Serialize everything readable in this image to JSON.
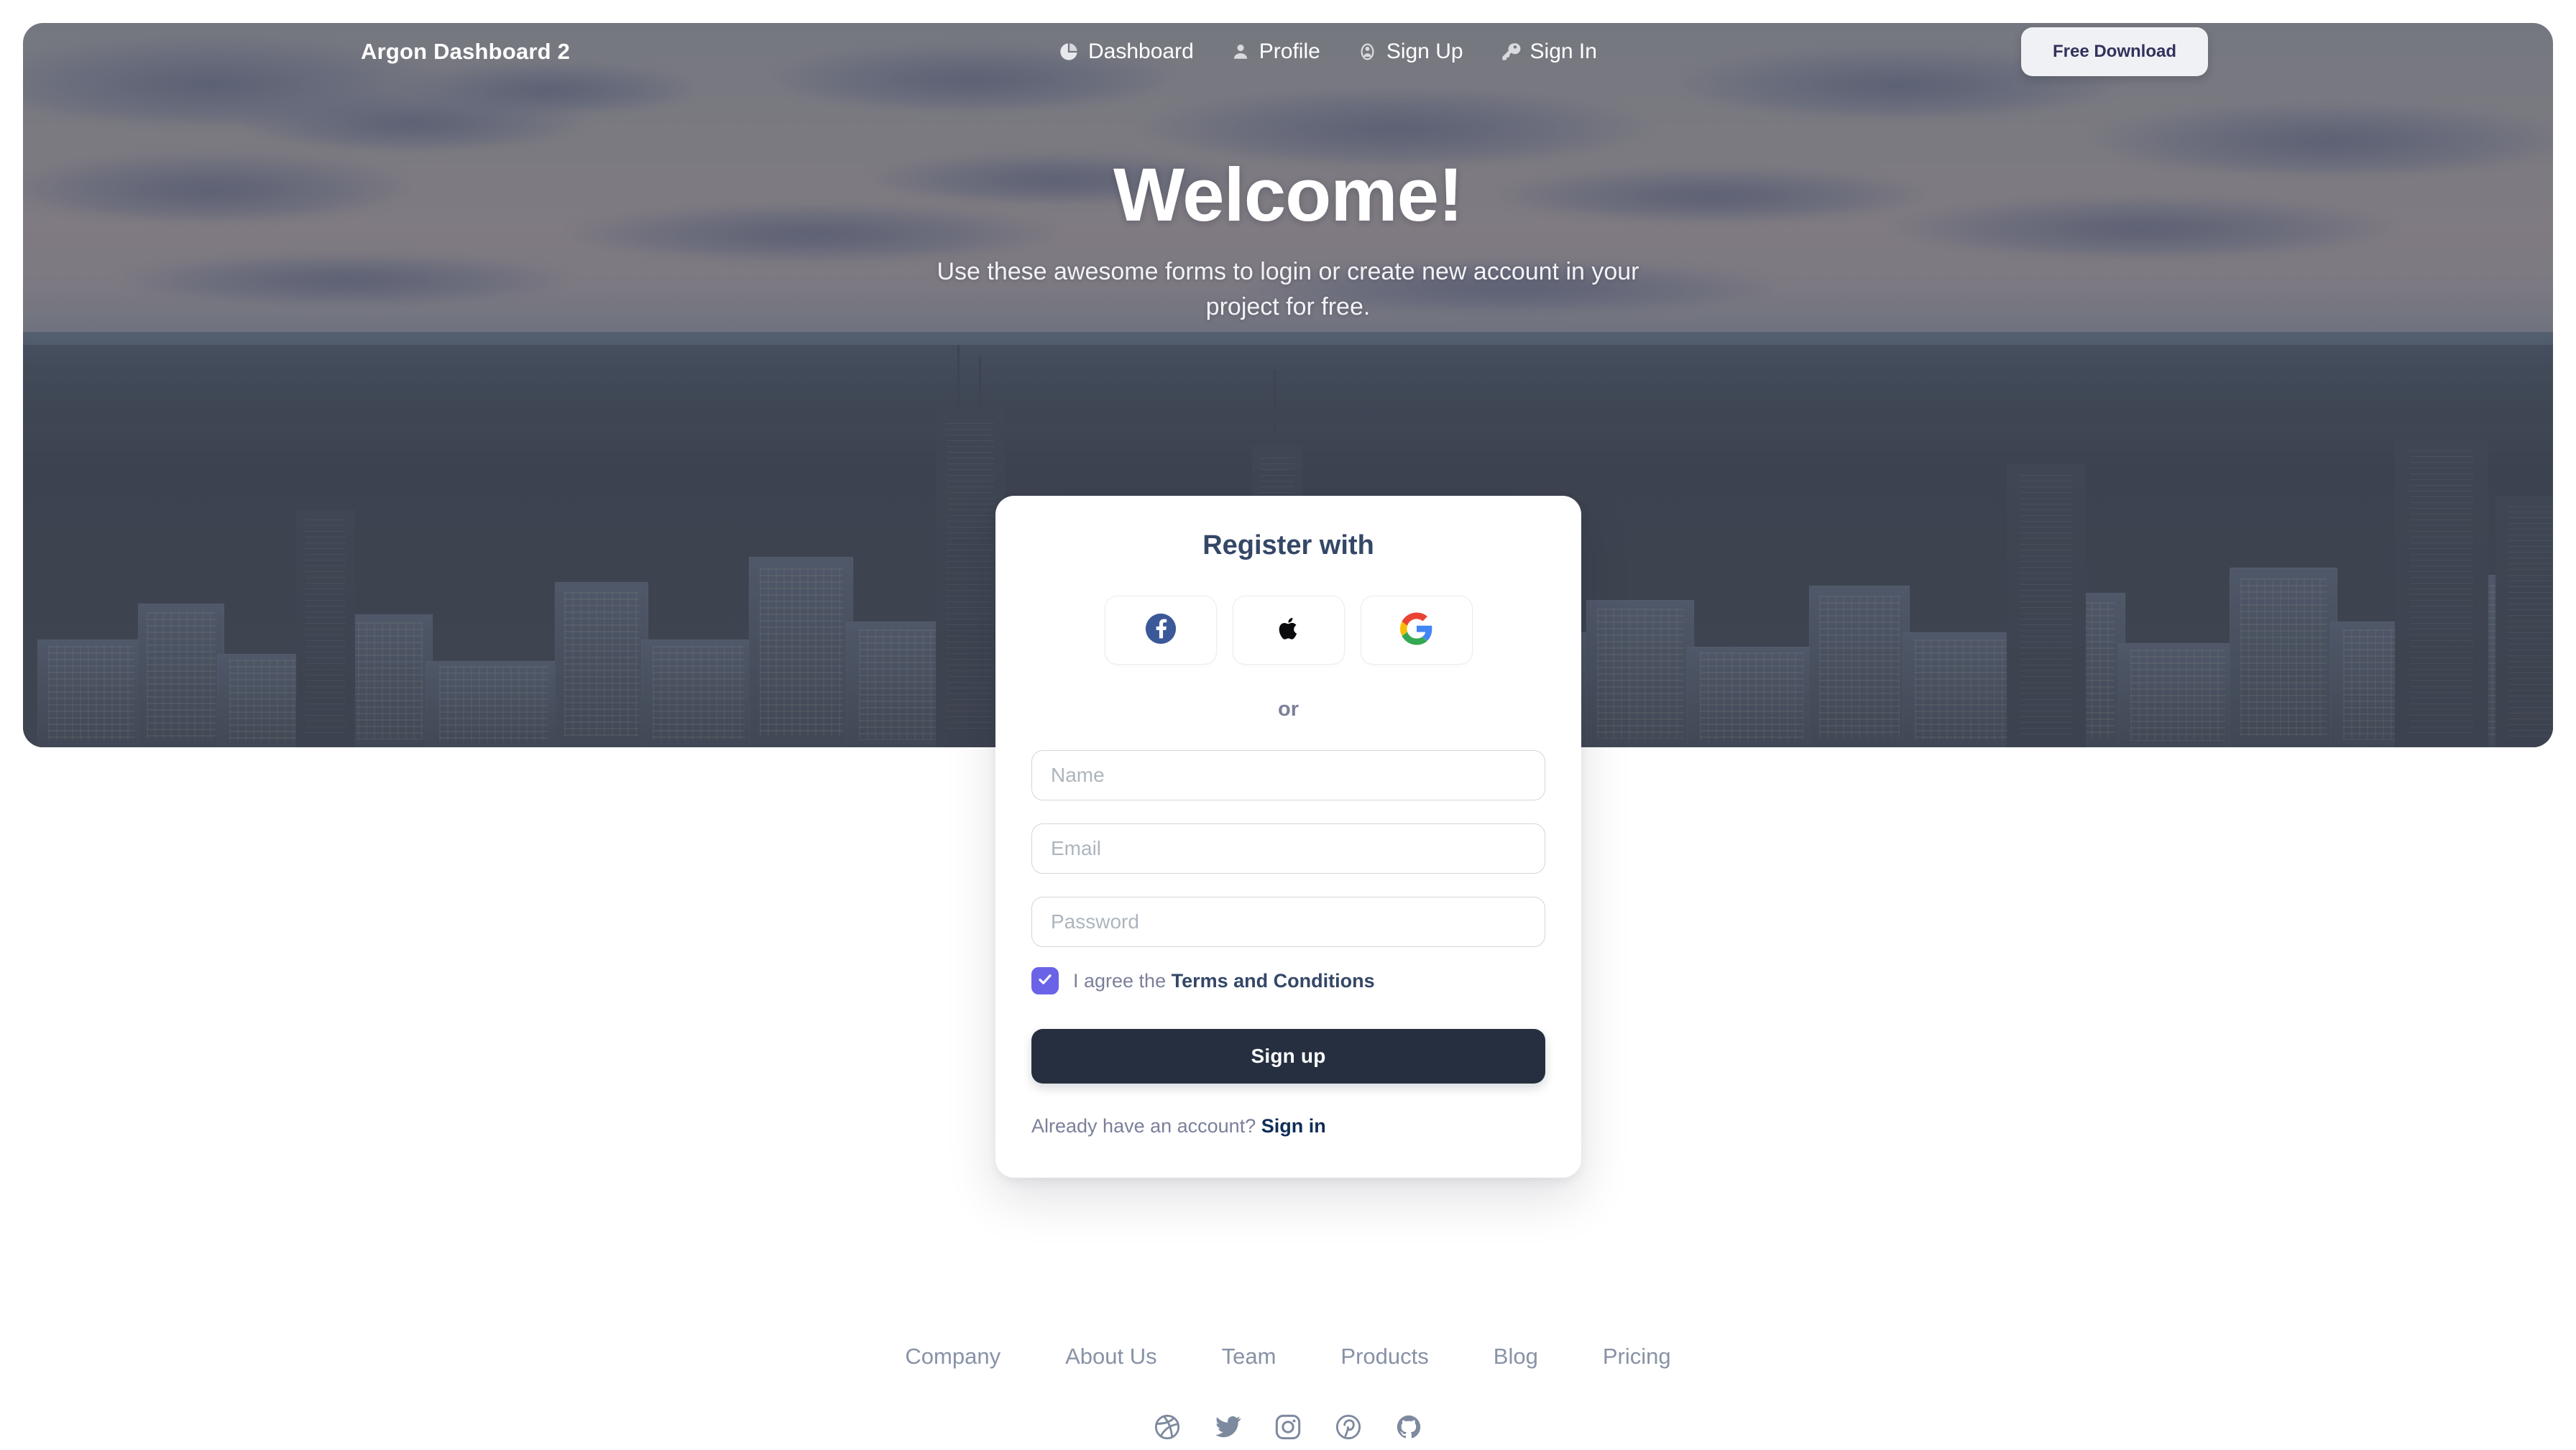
{
  "theme": {
    "accent_purple": "#6a63e8",
    "dark_navy": "#344767",
    "button_dark": "#252f3f",
    "muted_text": "#7b809a",
    "footer_link": "#8792a6",
    "page_background": "#ffffff",
    "hero_overlay": "rgba(88,92,102,0.46)",
    "facebook_blue": "#3b5998",
    "apple_black": "#0b0b0d",
    "google_red": "#ea4335",
    "google_yellow": "#fbbc05",
    "google_green": "#34a853",
    "google_blue": "#4285f4"
  },
  "navbar": {
    "brand": "Argon Dashboard 2",
    "links": [
      {
        "label": "Dashboard",
        "icon": "pie-chart-icon"
      },
      {
        "label": "Profile",
        "icon": "user-icon"
      },
      {
        "label": "Sign Up",
        "icon": "user-circle-icon"
      },
      {
        "label": "Sign In",
        "icon": "key-icon"
      }
    ],
    "cta_label": "Free Download"
  },
  "hero": {
    "title": "Welcome!",
    "subtitle": "Use these awesome forms to login or create new account in your project for free.",
    "background_description": "aerial-city-skyline-at-dusk"
  },
  "register_card": {
    "title": "Register with",
    "social_buttons": [
      {
        "name": "facebook",
        "icon": "facebook-icon"
      },
      {
        "name": "apple",
        "icon": "apple-icon"
      },
      {
        "name": "google",
        "icon": "google-icon"
      }
    ],
    "divider_label": "or",
    "fields": [
      {
        "name": "name",
        "placeholder": "Name",
        "value": "",
        "type": "text"
      },
      {
        "name": "email",
        "placeholder": "Email",
        "value": "",
        "type": "email"
      },
      {
        "name": "password",
        "placeholder": "Password",
        "value": "",
        "type": "password"
      }
    ],
    "terms": {
      "checked": true,
      "prefix": "I agree the ",
      "link_label": "Terms and Conditions"
    },
    "submit_label": "Sign up",
    "signin_prompt": {
      "prefix": "Already have an account? ",
      "link_label": "Sign in"
    }
  },
  "footer": {
    "links": [
      {
        "label": "Company"
      },
      {
        "label": "About Us"
      },
      {
        "label": "Team"
      },
      {
        "label": "Products"
      },
      {
        "label": "Blog"
      },
      {
        "label": "Pricing"
      }
    ],
    "social": [
      {
        "name": "dribbble",
        "icon": "dribbble-icon"
      },
      {
        "name": "twitter",
        "icon": "twitter-icon"
      },
      {
        "name": "instagram",
        "icon": "instagram-icon"
      },
      {
        "name": "pinterest",
        "icon": "pinterest-icon"
      },
      {
        "name": "github",
        "icon": "github-icon"
      }
    ]
  }
}
